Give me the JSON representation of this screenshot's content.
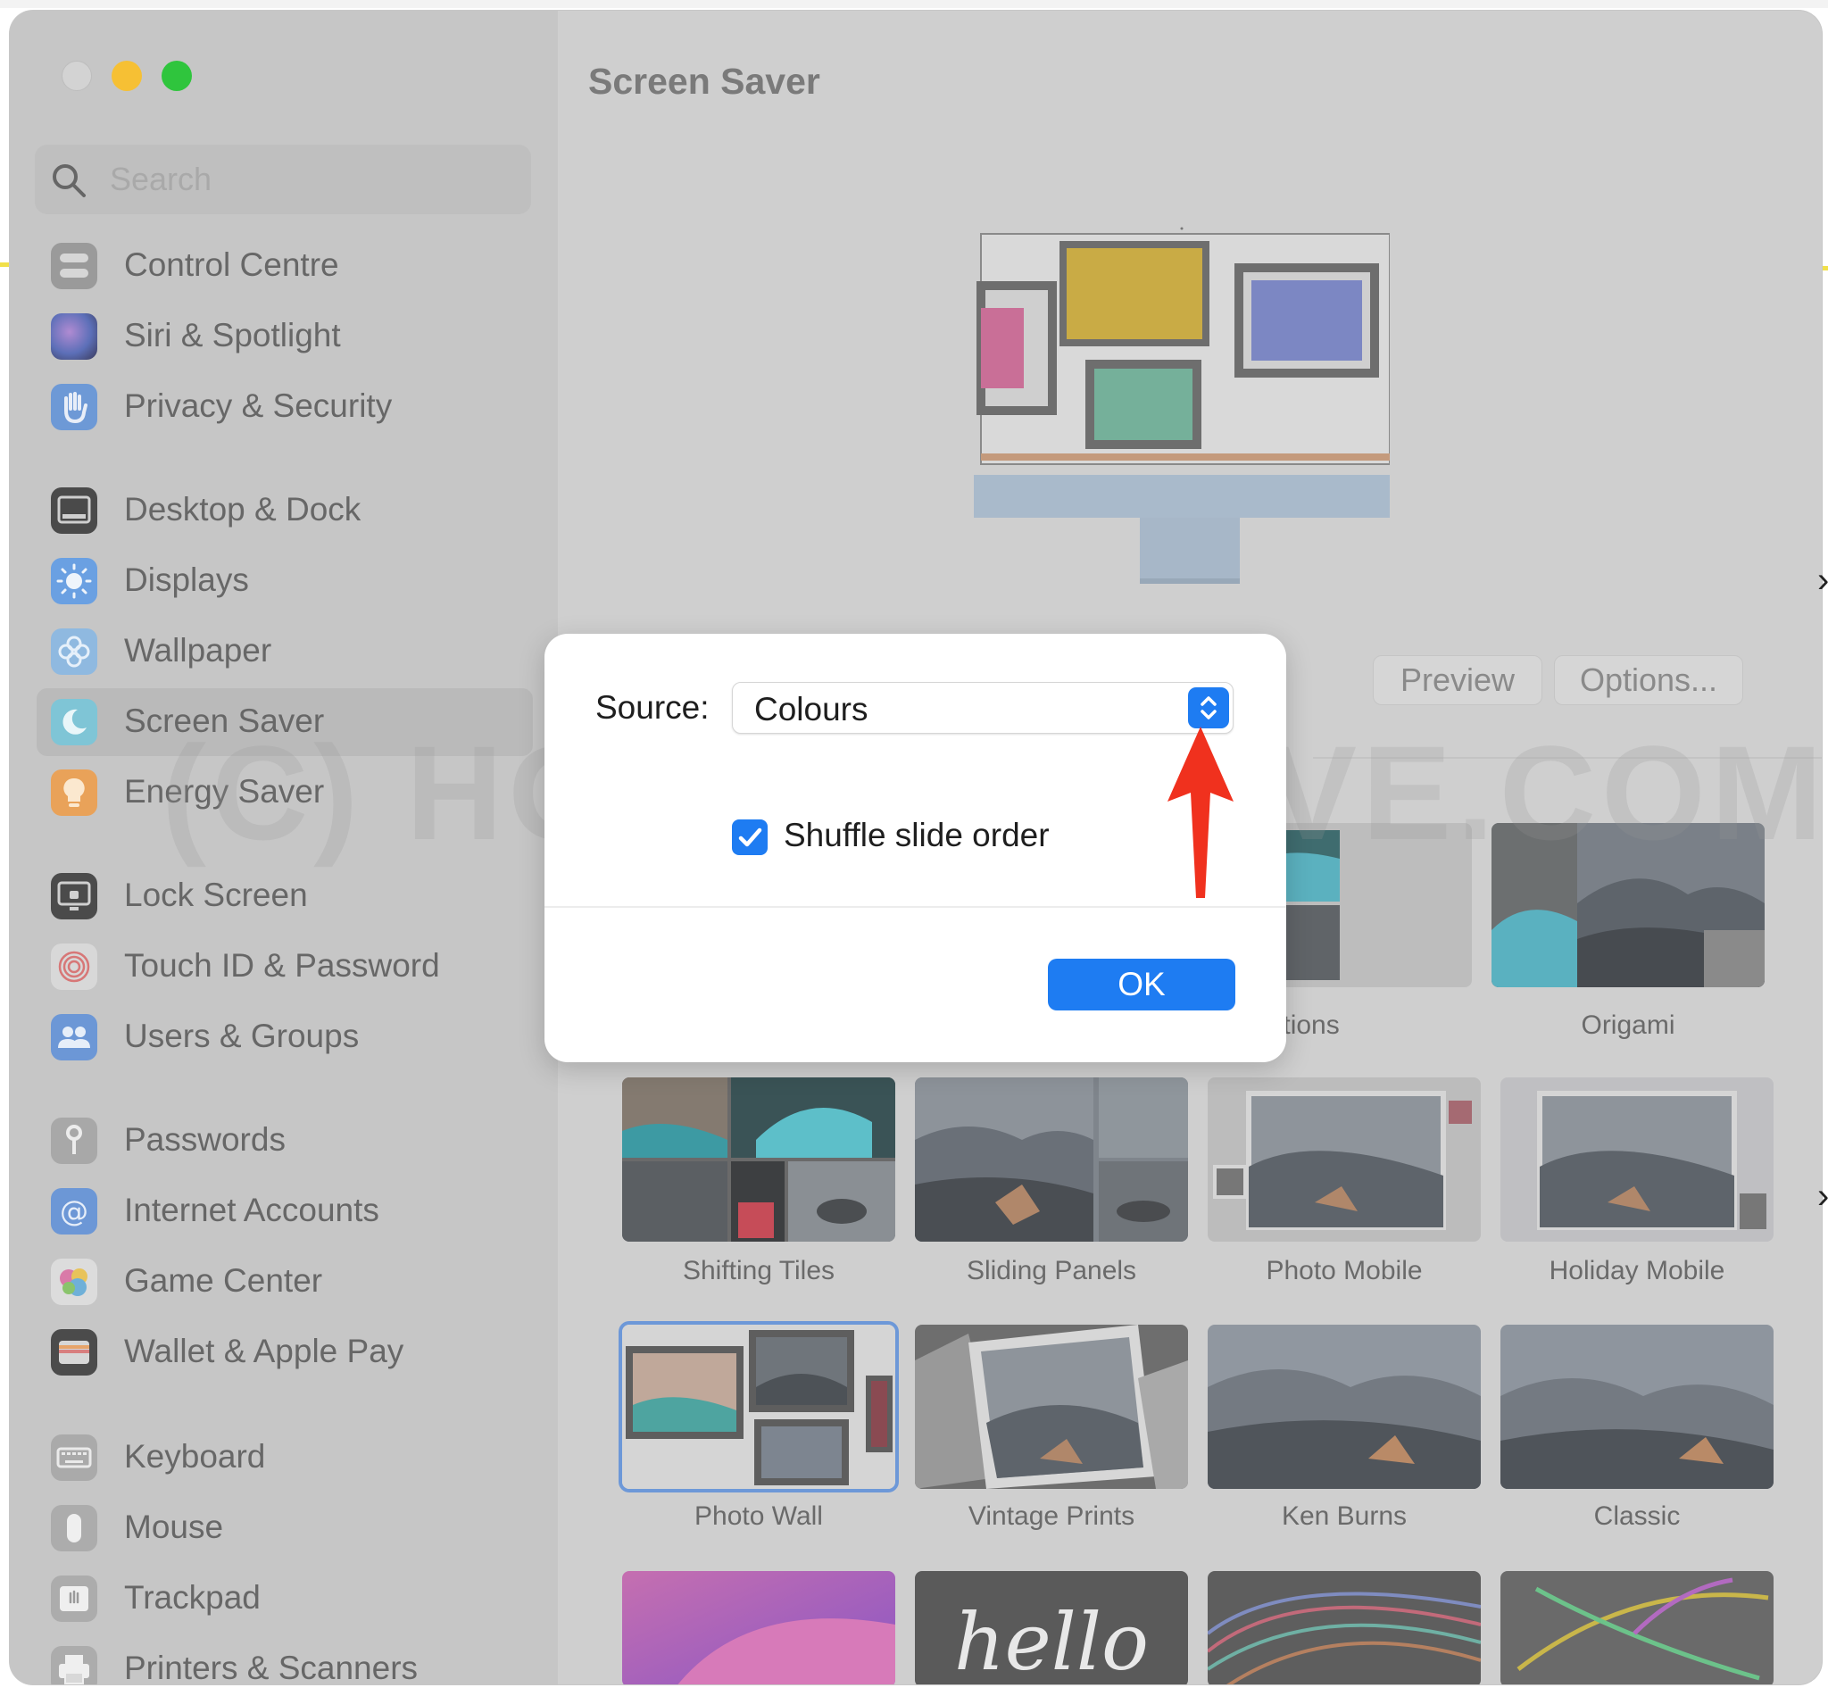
{
  "window": {
    "title": "Screen Saver"
  },
  "search": {
    "placeholder": "Search"
  },
  "sidebar": {
    "items": [
      {
        "label": "Control Centre",
        "icon": "control-centre-icon"
      },
      {
        "label": "Siri & Spotlight",
        "icon": "siri-icon"
      },
      {
        "label": "Privacy & Security",
        "icon": "hand-icon"
      },
      {
        "label": "Desktop & Dock",
        "icon": "dock-icon"
      },
      {
        "label": "Displays",
        "icon": "sun-icon"
      },
      {
        "label": "Wallpaper",
        "icon": "flower-icon"
      },
      {
        "label": "Screen Saver",
        "icon": "moon-icon"
      },
      {
        "label": "Energy Saver",
        "icon": "bulb-icon"
      },
      {
        "label": "Lock Screen",
        "icon": "lock-screen-icon"
      },
      {
        "label": "Touch ID & Password",
        "icon": "fingerprint-icon"
      },
      {
        "label": "Users & Groups",
        "icon": "users-icon"
      },
      {
        "label": "Passwords",
        "icon": "key-icon"
      },
      {
        "label": "Internet Accounts",
        "icon": "at-icon"
      },
      {
        "label": "Game Center",
        "icon": "game-center-icon"
      },
      {
        "label": "Wallet & Apple Pay",
        "icon": "wallet-icon"
      },
      {
        "label": "Keyboard",
        "icon": "keyboard-icon"
      },
      {
        "label": "Mouse",
        "icon": "mouse-icon"
      },
      {
        "label": "Trackpad",
        "icon": "trackpad-icon"
      },
      {
        "label": "Printers & Scanners",
        "icon": "printer-icon"
      }
    ],
    "selected": "Screen Saver"
  },
  "main": {
    "preview_label": "Preview",
    "options_label": "Options..."
  },
  "savers": [
    {
      "label": "eflections"
    },
    {
      "label": "Origami"
    },
    {
      "label": "Shifting Tiles"
    },
    {
      "label": "Sliding Panels"
    },
    {
      "label": "Photo Mobile"
    },
    {
      "label": "Holiday Mobile"
    },
    {
      "label": "Photo Wall"
    },
    {
      "label": "Vintage Prints"
    },
    {
      "label": "Ken Burns"
    },
    {
      "label": "Classic"
    },
    {
      "label": ""
    },
    {
      "label": "hello"
    },
    {
      "label": ""
    },
    {
      "label": ""
    }
  ],
  "selected_saver": "Photo Wall",
  "watermark": "(C) HOWTOISOLVE.COM",
  "dialog": {
    "source_label": "Source:",
    "source_value": "Colours",
    "shuffle_label": "Shuffle slide order",
    "shuffle_checked": true,
    "ok_label": "OK"
  },
  "colors": {
    "accent": "#1e7cf2",
    "arrow": "#f0311e",
    "traffic_min": "#f6c034",
    "traffic_max": "#2fc53d"
  }
}
